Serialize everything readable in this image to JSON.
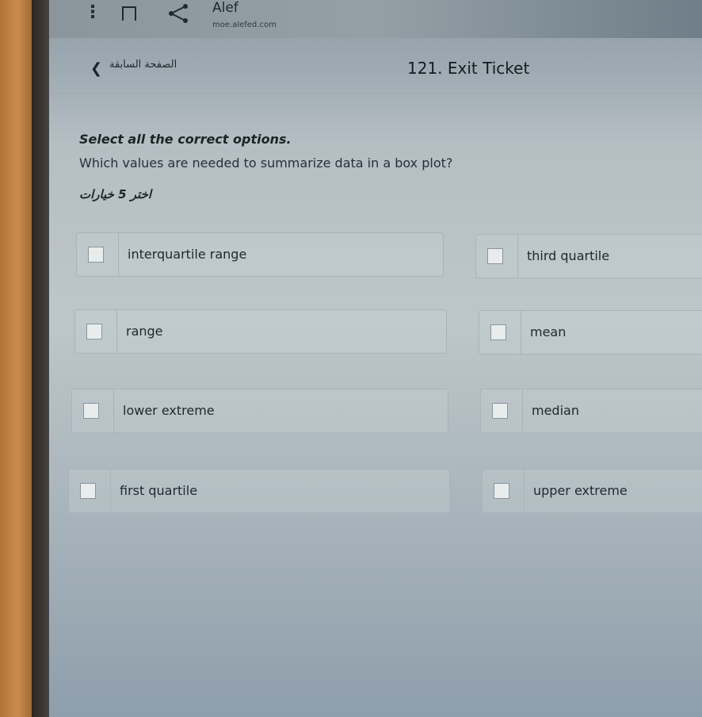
{
  "browser": {
    "site_title": "Alef",
    "site_url": "moe.alefed.com",
    "menu_glyph": "⋮"
  },
  "header": {
    "back_glyph": "❮",
    "back_label": "الصفحة السابقة",
    "page_title": "121. Exit Ticket"
  },
  "question": {
    "instruction": "Select all the correct options.",
    "text": "Which values are needed to summarize data in a box plot?",
    "arabic_note": "اختر 5 خيارات"
  },
  "options": [
    {
      "label": "interquartile range",
      "checked": false
    },
    {
      "label": "third quartile",
      "checked": false
    },
    {
      "label": "range",
      "checked": false
    },
    {
      "label": "mean",
      "checked": false
    },
    {
      "label": "lower extreme",
      "checked": false
    },
    {
      "label": "median",
      "checked": false
    },
    {
      "label": "first quartile",
      "checked": false
    },
    {
      "label": "upper extreme",
      "checked": false
    }
  ]
}
